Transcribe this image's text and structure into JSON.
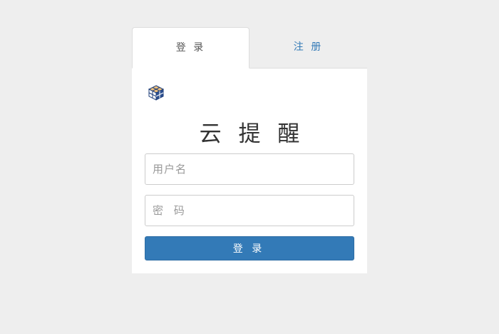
{
  "tabs": {
    "login_label": "登 录",
    "register_label": "注 册"
  },
  "logo": {
    "icon": "cube-logo-icon"
  },
  "title": "云 提 醒",
  "form": {
    "username_placeholder": "用户名",
    "password_placeholder": "密 码",
    "submit_label": "登 录"
  },
  "colors": {
    "background": "#eeeeee",
    "accent": "#337ab7",
    "card": "#ffffff"
  }
}
